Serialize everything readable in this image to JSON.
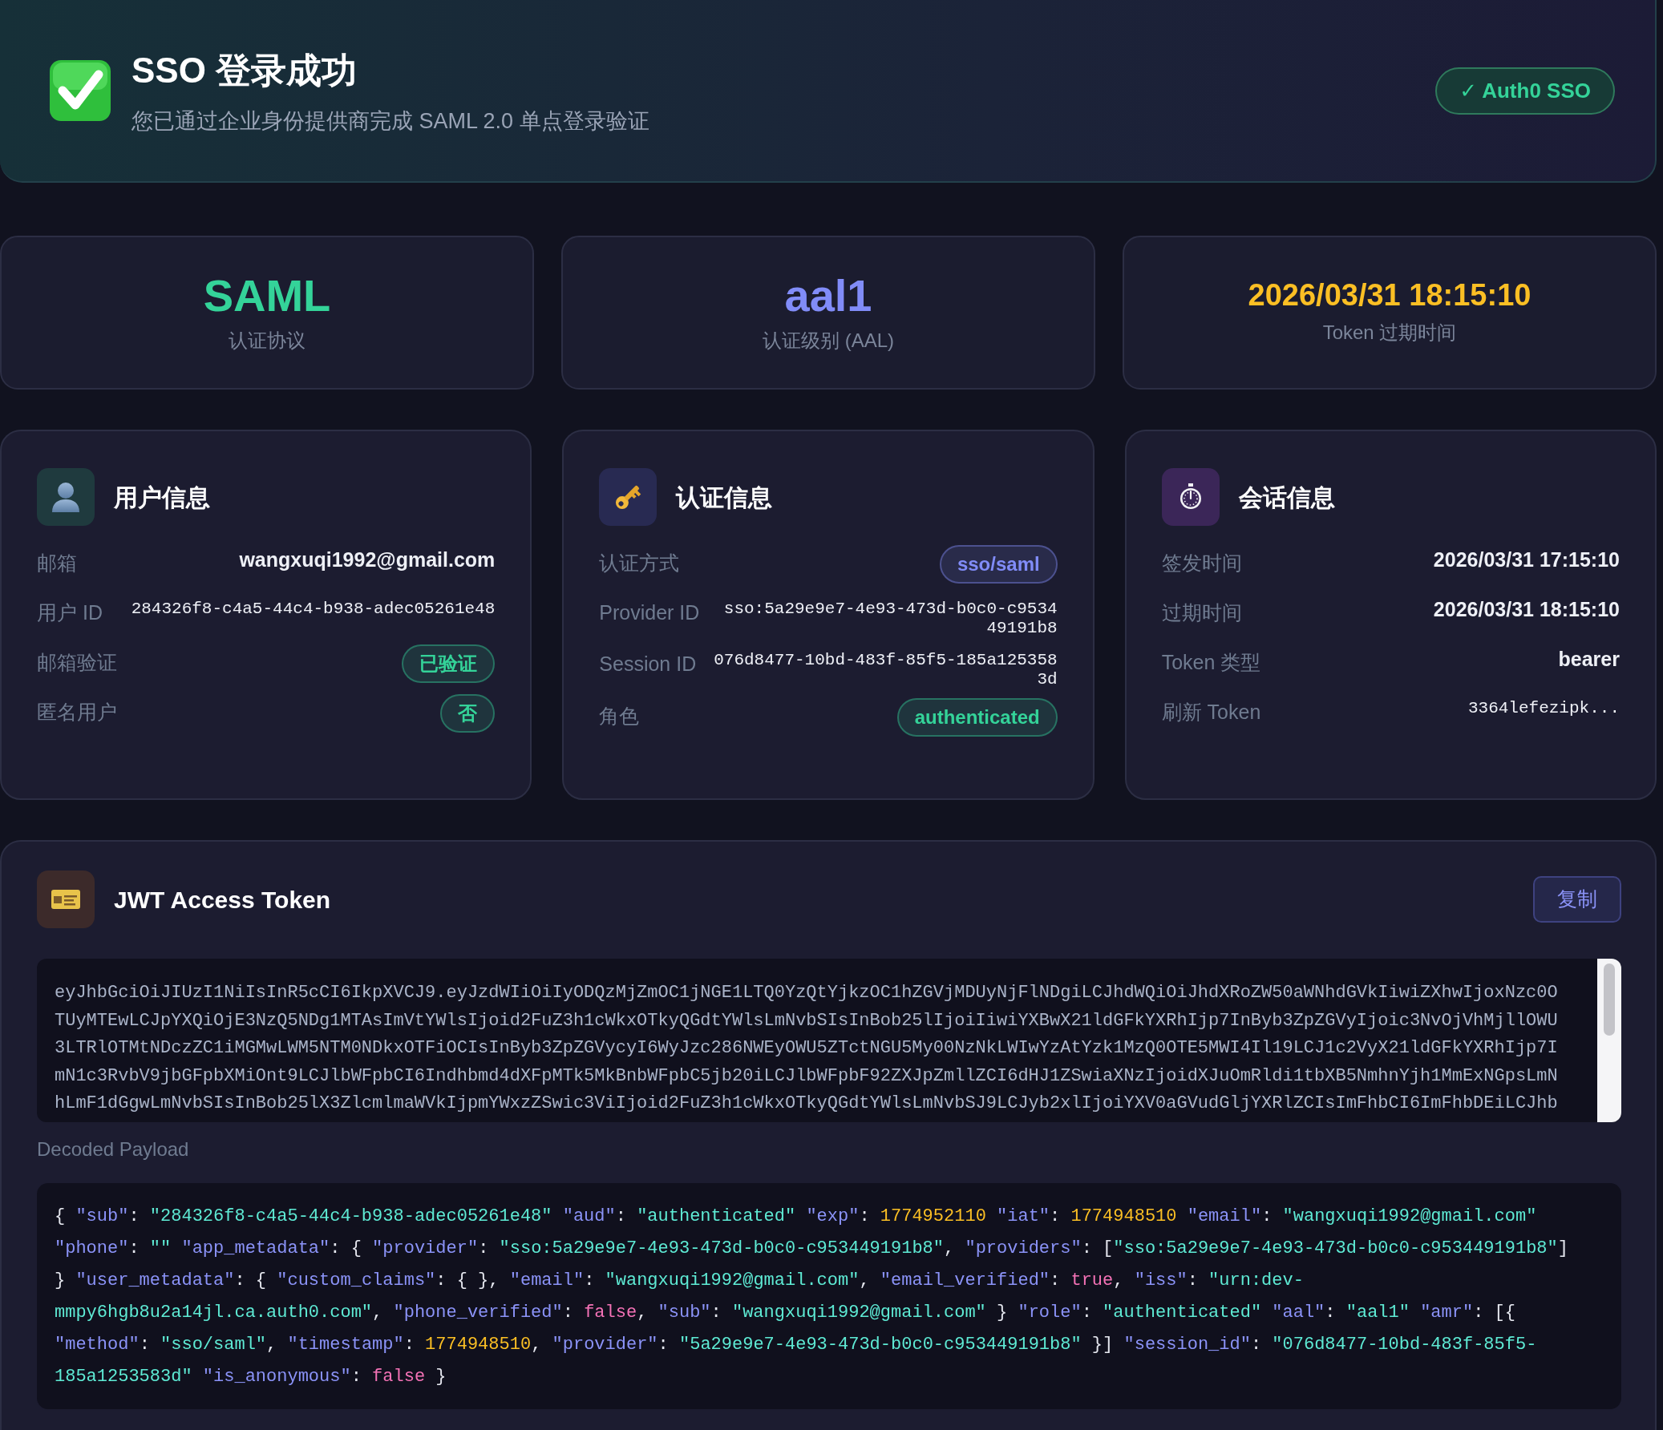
{
  "header": {
    "title": "SSO 登录成功",
    "subtitle": "您已通过企业身份提供商完成 SAML 2.0 单点登录验证",
    "badge": "✓ Auth0 SSO"
  },
  "stats": [
    {
      "value": "SAML",
      "label": "认证协议",
      "color": "#34d399",
      "kind": "big"
    },
    {
      "value": "aal1",
      "label": "认证级别 (AAL)",
      "color": "#818cf8",
      "kind": "big"
    },
    {
      "value": "2026/03/31 18:15:10",
      "label": "Token 过期时间",
      "color": "#fbbf24",
      "kind": "date"
    }
  ],
  "info_cards": [
    {
      "kind": "user",
      "title": "用户信息",
      "rows": [
        {
          "label": "邮箱",
          "value": "wangxuqi1992@gmail.com",
          "kind": "text"
        },
        {
          "label": "用户 ID",
          "value": "284326f8-c4a5-44c4-b938-adec05261e48",
          "kind": "mono"
        },
        {
          "label": "邮箱验证",
          "value": "已验证",
          "kind": "badge",
          "color": "#34d399"
        },
        {
          "label": "匿名用户",
          "value": "否",
          "kind": "badge",
          "color": "#34d399"
        }
      ]
    },
    {
      "kind": "auth",
      "title": "认证信息",
      "rows": [
        {
          "label": "认证方式",
          "value": "sso/saml",
          "kind": "badge",
          "color": "#818cf8"
        },
        {
          "label": "Provider ID",
          "value": "sso:5a29e9e7-4e93-473d-b0c0-c953449191b8",
          "kind": "mono"
        },
        {
          "label": "Session ID",
          "value": "076d8477-10bd-483f-85f5-185a1253583d",
          "kind": "mono"
        },
        {
          "label": "角色",
          "value": "authenticated",
          "kind": "badge",
          "color": "#34d399"
        }
      ]
    },
    {
      "kind": "session",
      "title": "会话信息",
      "rows": [
        {
          "label": "签发时间",
          "value": "2026/03/31 17:15:10",
          "kind": "text"
        },
        {
          "label": "过期时间",
          "value": "2026/03/31 18:15:10",
          "kind": "text"
        },
        {
          "label": "Token 类型",
          "value": "bearer",
          "kind": "text"
        },
        {
          "label": "刷新 Token",
          "value": "3364lefezipk...",
          "kind": "mono"
        }
      ]
    }
  ],
  "token": {
    "title": "JWT Access Token",
    "copy_button": "复制",
    "lines": [
      "eyJhbGciOiJIUzI1NiIsInR5cCI6IkpXVCJ9.eyJzdWIiOiIyODQzMjZmOC1jNGE1LTQ0YzQtYjkzOC1hZGVjMDUyNjFlNDgiLCJhdWQiOiJhdXRoZW50aWNhdGVkIiwiZXhwIjoxNzc0O",
      "TUyMTEwLCJpYXQiOjE3NzQ5NDg1MTAsImVtYWlsIjoid2FuZ3h1cWkxOTkyQGdtYWlsLmNvbSIsInBob25lIjoiIiwiYXBwX21ldGFkYXRhIjp7InByb3ZpZGVyIjoic3NvOjVhMjllOWU",
      "3LTRlOTMtNDczZC1iMGMwLWM5NTM0NDkxOTFiOCIsInByb3ZpZGVycyI6WyJzc286NWEyOWU5ZTctNGU5My00NzNkLWIwYzAtYzk1MzQ0OTE5MWI4Il19LCJ1c2VyX21ldGFkYXRhIjp7I",
      "mN1c3RvbV9jbGFpbXMiOnt9LCJlbWFpbCI6Indhbmd4dXFpMTk5MkBnbWFpbC5jb20iLCJlbWFpbF92ZXJpZmllZCI6dHJ1ZSwiaXNzIjoidXJuOmRldi1tbXB5NmhnYjh1MmExNGpsLmN",
      "hLmF1dGgwLmNvbSIsInBob25lX3ZlcmlmaWVkIjpmYWxzZSwic3ViIjoid2FuZ3h1cWkxOTkyQGdtYWlsLmNvbSJ9LCJyb2xlIjoiYXV0aGVudGljYXRlZCIsImFhbCI6ImFhbDEiLCJhb"
    ],
    "payload_label": "Decoded Payload",
    "payload_lines": [
      [
        {
          "kind": "punct",
          "text": "{ "
        },
        {
          "kind": "key",
          "text": "\"sub\""
        },
        {
          "kind": "punct",
          "text": ": "
        },
        {
          "kind": "string",
          "text": "\"284326f8-c4a5-44c4-b938-adec05261e48\""
        },
        {
          "kind": "key",
          "text": " \"aud\""
        },
        {
          "kind": "punct",
          "text": ": "
        },
        {
          "kind": "string",
          "text": "\"authenticated\""
        },
        {
          "kind": "key",
          "text": " \"exp\""
        },
        {
          "kind": "punct",
          "text": ": "
        },
        {
          "kind": "number",
          "text": "1774952110"
        },
        {
          "kind": "key",
          "text": " \"iat\""
        },
        {
          "kind": "punct",
          "text": ": "
        },
        {
          "kind": "number",
          "text": "1774948510"
        },
        {
          "kind": "key",
          "text": " \"email\""
        },
        {
          "kind": "punct",
          "text": ": "
        },
        {
          "kind": "string",
          "text": "\"wangxuqi1992@gmail.com\""
        }
      ],
      [
        {
          "kind": "key",
          "text": "\"phone\""
        },
        {
          "kind": "punct",
          "text": ": "
        },
        {
          "kind": "string",
          "text": "\"\""
        },
        {
          "kind": "key",
          "text": " \"app_metadata\""
        },
        {
          "kind": "punct",
          "text": ": { "
        },
        {
          "kind": "key",
          "text": "\"provider\""
        },
        {
          "kind": "punct",
          "text": ": "
        },
        {
          "kind": "string",
          "text": "\"sso:5a29e9e7-4e93-473d-b0c0-c953449191b8\""
        },
        {
          "kind": "punct",
          "text": ", "
        },
        {
          "kind": "key",
          "text": "\"providers\""
        },
        {
          "kind": "punct",
          "text": ": ["
        },
        {
          "kind": "string",
          "text": "\"sso:5a29e9e7-4e93-473d-b0c0-c953449191b8\""
        },
        {
          "kind": "punct",
          "text": "]"
        }
      ],
      [
        {
          "kind": "punct",
          "text": "} "
        },
        {
          "kind": "key",
          "text": "\"user_metadata\""
        },
        {
          "kind": "punct",
          "text": ": { "
        },
        {
          "kind": "key",
          "text": "\"custom_claims\""
        },
        {
          "kind": "punct",
          "text": ": { }, "
        },
        {
          "kind": "key",
          "text": "\"email\""
        },
        {
          "kind": "punct",
          "text": ": "
        },
        {
          "kind": "string",
          "text": "\"wangxuqi1992@gmail.com\""
        },
        {
          "kind": "punct",
          "text": ", "
        },
        {
          "kind": "key",
          "text": "\"email_verified\""
        },
        {
          "kind": "punct",
          "text": ": "
        },
        {
          "kind": "bool",
          "text": "true"
        },
        {
          "kind": "punct",
          "text": ", "
        },
        {
          "kind": "key",
          "text": "\"iss\""
        },
        {
          "kind": "punct",
          "text": ": "
        },
        {
          "kind": "string",
          "text": "\"urn:dev-"
        }
      ],
      [
        {
          "kind": "string",
          "text": "mmpy6hgb8u2a14jl.ca.auth0.com\""
        },
        {
          "kind": "punct",
          "text": ", "
        },
        {
          "kind": "key",
          "text": "\"phone_verified\""
        },
        {
          "kind": "punct",
          "text": ": "
        },
        {
          "kind": "bool",
          "text": "false"
        },
        {
          "kind": "punct",
          "text": ", "
        },
        {
          "kind": "key",
          "text": "\"sub\""
        },
        {
          "kind": "punct",
          "text": ": "
        },
        {
          "kind": "string",
          "text": "\"wangxuqi1992@gmail.com\""
        },
        {
          "kind": "punct",
          "text": " } "
        },
        {
          "kind": "key",
          "text": "\"role\""
        },
        {
          "kind": "punct",
          "text": ": "
        },
        {
          "kind": "string",
          "text": "\"authenticated\""
        },
        {
          "kind": "key",
          "text": " \"aal\""
        },
        {
          "kind": "punct",
          "text": ": "
        },
        {
          "kind": "string",
          "text": "\"aal1\""
        },
        {
          "kind": "key",
          "text": " \"amr\""
        },
        {
          "kind": "punct",
          "text": ": [{"
        }
      ],
      [
        {
          "kind": "key",
          "text": "\"method\""
        },
        {
          "kind": "punct",
          "text": ": "
        },
        {
          "kind": "string",
          "text": "\"sso/saml\""
        },
        {
          "kind": "punct",
          "text": ", "
        },
        {
          "kind": "key",
          "text": "\"timestamp\""
        },
        {
          "kind": "punct",
          "text": ": "
        },
        {
          "kind": "number",
          "text": "1774948510"
        },
        {
          "kind": "punct",
          "text": ", "
        },
        {
          "kind": "key",
          "text": "\"provider\""
        },
        {
          "kind": "punct",
          "text": ": "
        },
        {
          "kind": "string",
          "text": "\"5a29e9e7-4e93-473d-b0c0-c953449191b8\""
        },
        {
          "kind": "punct",
          "text": " }] "
        },
        {
          "kind": "key",
          "text": "\"session_id\""
        },
        {
          "kind": "punct",
          "text": ": "
        },
        {
          "kind": "string",
          "text": "\"076d8477-10bd-483f-85f5-"
        }
      ],
      [
        {
          "kind": "string",
          "text": "185a1253583d\""
        },
        {
          "kind": "key",
          "text": " \"is_anonymous\""
        },
        {
          "kind": "punct",
          "text": ": "
        },
        {
          "kind": "bool",
          "text": "false"
        },
        {
          "kind": "punct",
          "text": " }"
        }
      ]
    ]
  }
}
